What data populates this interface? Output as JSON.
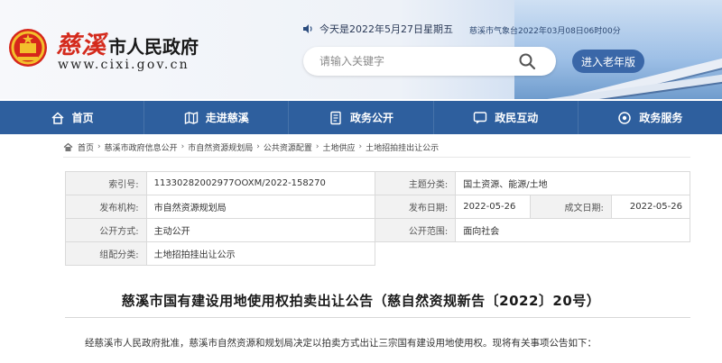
{
  "header": {
    "logo_cn_red": "慈溪",
    "logo_cn_black": "市人民政府",
    "logo_url": "www.cixi.gov.cn",
    "date_text": "今天是2022年5月27日星期五",
    "weather_text": "慈溪市气象台2022年03月08日06时00分",
    "search_placeholder": "请输入关键字",
    "elder_button": "进入老年版"
  },
  "nav": {
    "items": [
      {
        "label": "首页",
        "icon": "home-icon"
      },
      {
        "label": "走进慈溪",
        "icon": "map-icon"
      },
      {
        "label": "政务公开",
        "icon": "document-icon"
      },
      {
        "label": "政民互动",
        "icon": "chat-icon"
      },
      {
        "label": "政务服务",
        "icon": "service-icon"
      }
    ]
  },
  "breadcrumb": [
    "首页",
    "慈溪市政府信息公开",
    "市自然资源规划局",
    "公共资源配置",
    "土地供应",
    "土地招拍挂出让公示"
  ],
  "info": {
    "index_label": "索引号:",
    "index_value": "11330282002977OOXM/2022-158270",
    "theme_label": "主题分类:",
    "theme_value": "国土资源、能源/土地",
    "org_label": "发布机构:",
    "org_value": "市自然资源规划局",
    "pubdate_label": "发布日期:",
    "pubdate_value": "2022-05-26",
    "gendate_label": "成文日期:",
    "gendate_value": "2022-05-26",
    "mode_label": "公开方式:",
    "mode_value": "主动公开",
    "scope_label": "公开范围:",
    "scope_value": "面向社会",
    "group_label": "组配分类:",
    "group_value": "土地招拍挂出让公示"
  },
  "article": {
    "title": "慈溪市国有建设用地使用权拍卖出让公告（慈自然资规新告〔2022〕20号）",
    "intro": "经慈溪市人民政府批准，慈溪市自然资源和规划局决定以拍卖方式出让三宗国有建设用地使用权。现将有关事项公告如下："
  },
  "colors": {
    "nav_bg": "#2e5f9e",
    "logo_red": "#d42a1c",
    "elder_button_bg": "#3a67a8"
  }
}
